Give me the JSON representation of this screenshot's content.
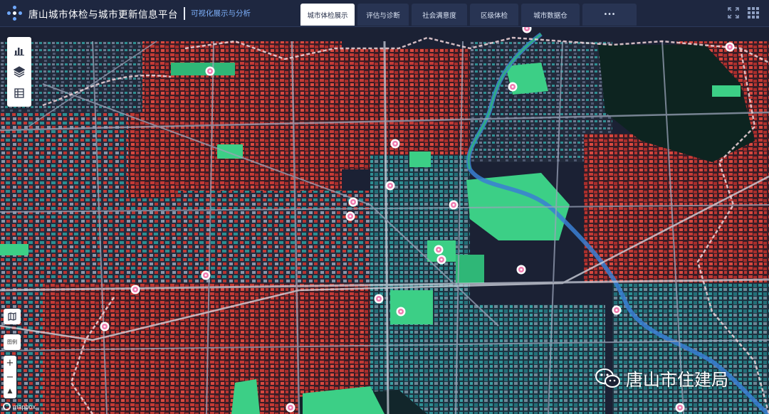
{
  "header": {
    "title": "唐山城市体检与城市更新信息平台",
    "subtitle": "可视化展示与分析",
    "tabs": [
      {
        "label": "城市体检展示",
        "active": true
      },
      {
        "label": "评估与诊断",
        "active": false
      },
      {
        "label": "社会满意度",
        "active": false
      },
      {
        "label": "区级体检",
        "active": false
      },
      {
        "label": "城市数据仓",
        "active": false
      },
      {
        "label": "•••",
        "active": false
      }
    ]
  },
  "toolbar": {
    "icons": [
      "chart-icon",
      "layers-icon",
      "table-icon"
    ]
  },
  "map_controls": {
    "legend_label": "图例",
    "zoom_in": "+",
    "zoom_out": "−",
    "compass": "▲",
    "attribution": "mapbox"
  },
  "watermark": {
    "text": "唐山市住建局"
  },
  "colors": {
    "header_bg": "#1e2740",
    "map_bg": "#1b2134",
    "building_red": "#c43a35",
    "building_teal": "#2e8e92",
    "park_green": "#3ccf86",
    "road": "#9aa3b8",
    "marker_pink": "#f07cb0",
    "boundary": "#f2d7dc"
  }
}
